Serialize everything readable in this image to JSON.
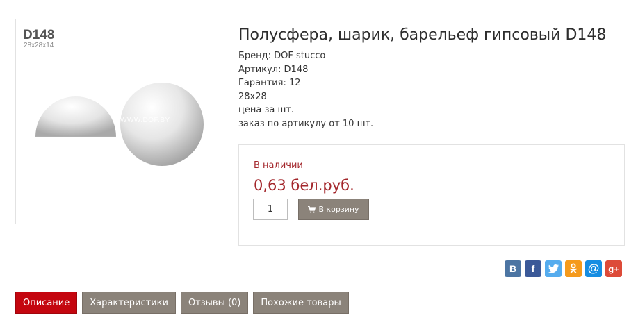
{
  "image": {
    "code": "D148",
    "dims": "28x28x14",
    "watermark": "WWW.DOF.BY"
  },
  "product": {
    "title": "Полусфера, шарик, барельеф гипсовый D148",
    "brand": "Бренд: DOF stucco",
    "article": "Артикул: D148",
    "warranty": "Гарантия: 12",
    "size": "28x28",
    "unit_note": "цена за шт.",
    "order_note": "заказ по артикулу от 10 шт."
  },
  "buy": {
    "stock": "В наличии",
    "price": "0,63 бел.руб.",
    "quantity": "1",
    "cart_label": "В корзину"
  },
  "share": [
    {
      "icon": "vk-icon",
      "glyph": "B",
      "color": "#4c75a3"
    },
    {
      "icon": "facebook-icon",
      "glyph": "f",
      "color": "#3b5998"
    },
    {
      "icon": "twitter-icon",
      "glyph": "t",
      "color": "#55acee"
    },
    {
      "icon": "odnoklassniki-icon",
      "glyph": "ok",
      "color": "#f59a1c"
    },
    {
      "icon": "mail-icon",
      "glyph": "@",
      "color": "#168de2"
    },
    {
      "icon": "google-plus-icon",
      "glyph": "g+",
      "color": "#dd4b39"
    }
  ],
  "tabs": [
    {
      "label": "Описание",
      "active": true
    },
    {
      "label": "Характеристики",
      "active": false
    },
    {
      "label": "Отзывы (0)",
      "active": false
    },
    {
      "label": "Похожие товары",
      "active": false
    }
  ],
  "colors": {
    "accent_red": "#c4060f",
    "price_red": "#a3262b",
    "button_grey": "#8b837a"
  }
}
